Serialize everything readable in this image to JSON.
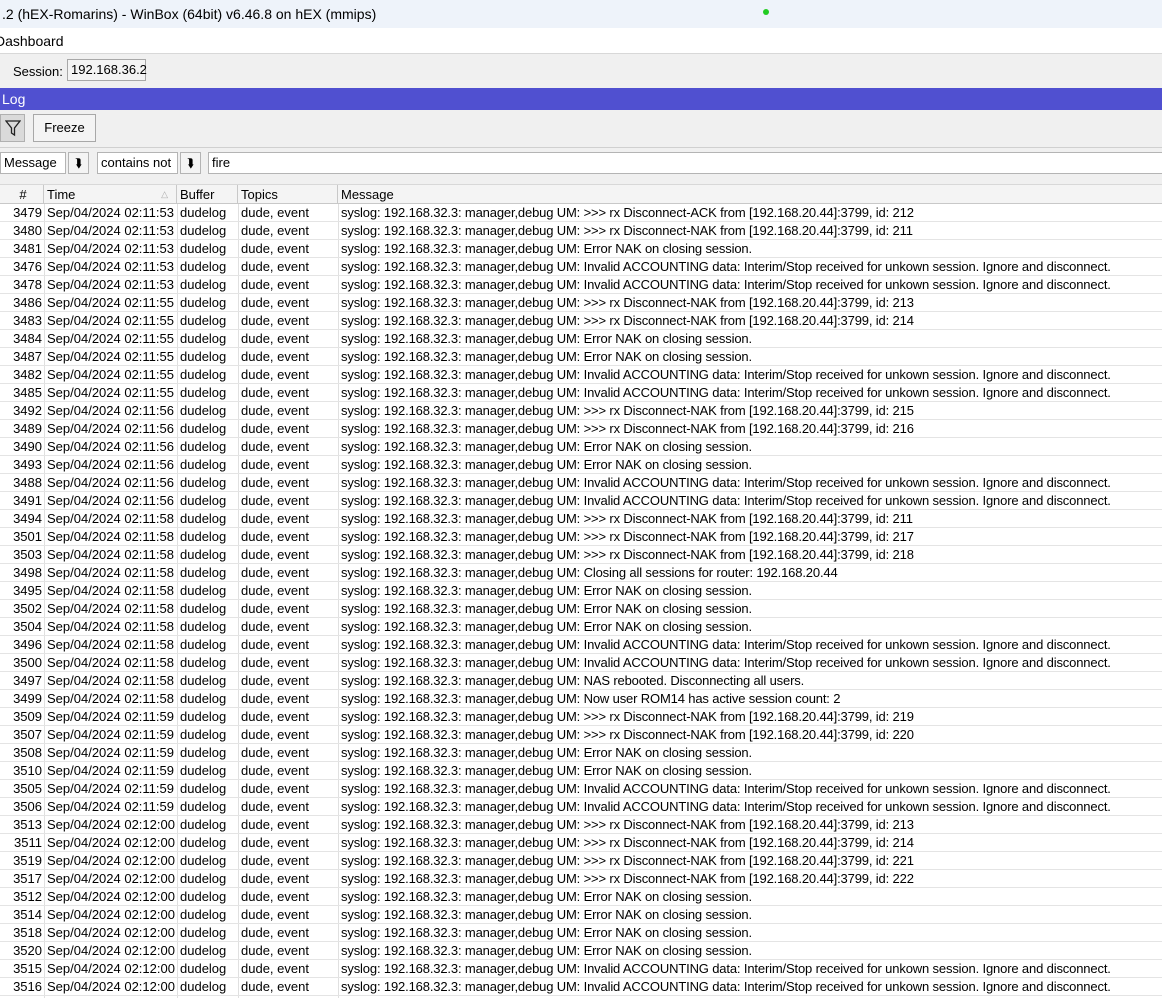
{
  "window": {
    "title": ".2 (hEX-Romarins) - WinBox (64bit) v6.46.8 on hEX (mmips)",
    "status_color": "#22cc22"
  },
  "menu": {
    "item": "Dashboard"
  },
  "session": {
    "label": "Session:",
    "value": "192.168.36.2"
  },
  "log": {
    "title": "Log",
    "title_color": "#5050d0"
  },
  "toolbar": {
    "filter_icon": "funnel-icon",
    "freeze_label": "Freeze"
  },
  "filter": {
    "field": "Message",
    "operator": "contains not",
    "value": "fire"
  },
  "columns": [
    "#",
    "Time",
    "Buffer",
    "Topics",
    "Message"
  ],
  "sort": {
    "column": "Time",
    "icon": "sort-ascending-icon"
  },
  "rows": [
    [
      "3479",
      "Sep/04/2024 02:11:53",
      "dudelog",
      "dude, event",
      "syslog: 192.168.32.3: manager,debug UM: >>> rx Disconnect-ACK from [192.168.20.44]:3799, id: 212"
    ],
    [
      "3480",
      "Sep/04/2024 02:11:53",
      "dudelog",
      "dude, event",
      "syslog: 192.168.32.3: manager,debug UM: >>> rx Disconnect-NAK from [192.168.20.44]:3799, id: 211"
    ],
    [
      "3481",
      "Sep/04/2024 02:11:53",
      "dudelog",
      "dude, event",
      "syslog: 192.168.32.3: manager,debug UM: Error NAK on closing session."
    ],
    [
      "3476",
      "Sep/04/2024 02:11:53",
      "dudelog",
      "dude, event",
      "syslog: 192.168.32.3: manager,debug UM: Invalid ACCOUNTING data: Interim/Stop received for unkown session. Ignore and disconnect."
    ],
    [
      "3478",
      "Sep/04/2024 02:11:53",
      "dudelog",
      "dude, event",
      "syslog: 192.168.32.3: manager,debug UM: Invalid ACCOUNTING data: Interim/Stop received for unkown session. Ignore and disconnect."
    ],
    [
      "3486",
      "Sep/04/2024 02:11:55",
      "dudelog",
      "dude, event",
      "syslog: 192.168.32.3: manager,debug UM: >>> rx Disconnect-NAK from [192.168.20.44]:3799, id: 213"
    ],
    [
      "3483",
      "Sep/04/2024 02:11:55",
      "dudelog",
      "dude, event",
      "syslog: 192.168.32.3: manager,debug UM: >>> rx Disconnect-NAK from [192.168.20.44]:3799, id: 214"
    ],
    [
      "3484",
      "Sep/04/2024 02:11:55",
      "dudelog",
      "dude, event",
      "syslog: 192.168.32.3: manager,debug UM: Error NAK on closing session."
    ],
    [
      "3487",
      "Sep/04/2024 02:11:55",
      "dudelog",
      "dude, event",
      "syslog: 192.168.32.3: manager,debug UM: Error NAK on closing session."
    ],
    [
      "3482",
      "Sep/04/2024 02:11:55",
      "dudelog",
      "dude, event",
      "syslog: 192.168.32.3: manager,debug UM: Invalid ACCOUNTING data: Interim/Stop received for unkown session. Ignore and disconnect."
    ],
    [
      "3485",
      "Sep/04/2024 02:11:55",
      "dudelog",
      "dude, event",
      "syslog: 192.168.32.3: manager,debug UM: Invalid ACCOUNTING data: Interim/Stop received for unkown session. Ignore and disconnect."
    ],
    [
      "3492",
      "Sep/04/2024 02:11:56",
      "dudelog",
      "dude, event",
      "syslog: 192.168.32.3: manager,debug UM: >>> rx Disconnect-NAK from [192.168.20.44]:3799, id: 215"
    ],
    [
      "3489",
      "Sep/04/2024 02:11:56",
      "dudelog",
      "dude, event",
      "syslog: 192.168.32.3: manager,debug UM: >>> rx Disconnect-NAK from [192.168.20.44]:3799, id: 216"
    ],
    [
      "3490",
      "Sep/04/2024 02:11:56",
      "dudelog",
      "dude, event",
      "syslog: 192.168.32.3: manager,debug UM: Error NAK on closing session."
    ],
    [
      "3493",
      "Sep/04/2024 02:11:56",
      "dudelog",
      "dude, event",
      "syslog: 192.168.32.3: manager,debug UM: Error NAK on closing session."
    ],
    [
      "3488",
      "Sep/04/2024 02:11:56",
      "dudelog",
      "dude, event",
      "syslog: 192.168.32.3: manager,debug UM: Invalid ACCOUNTING data: Interim/Stop received for unkown session. Ignore and disconnect."
    ],
    [
      "3491",
      "Sep/04/2024 02:11:56",
      "dudelog",
      "dude, event",
      "syslog: 192.168.32.3: manager,debug UM: Invalid ACCOUNTING data: Interim/Stop received for unkown session. Ignore and disconnect."
    ],
    [
      "3494",
      "Sep/04/2024 02:11:58",
      "dudelog",
      "dude, event",
      "syslog: 192.168.32.3: manager,debug UM: >>> rx Disconnect-NAK from [192.168.20.44]:3799, id: 211"
    ],
    [
      "3501",
      "Sep/04/2024 02:11:58",
      "dudelog",
      "dude, event",
      "syslog: 192.168.32.3: manager,debug UM: >>> rx Disconnect-NAK from [192.168.20.44]:3799, id: 217"
    ],
    [
      "3503",
      "Sep/04/2024 02:11:58",
      "dudelog",
      "dude, event",
      "syslog: 192.168.32.3: manager,debug UM: >>> rx Disconnect-NAK from [192.168.20.44]:3799, id: 218"
    ],
    [
      "3498",
      "Sep/04/2024 02:11:58",
      "dudelog",
      "dude, event",
      "syslog: 192.168.32.3: manager,debug UM: Closing all sessions for router: 192.168.20.44"
    ],
    [
      "3495",
      "Sep/04/2024 02:11:58",
      "dudelog",
      "dude, event",
      "syslog: 192.168.32.3: manager,debug UM: Error NAK on closing session."
    ],
    [
      "3502",
      "Sep/04/2024 02:11:58",
      "dudelog",
      "dude, event",
      "syslog: 192.168.32.3: manager,debug UM: Error NAK on closing session."
    ],
    [
      "3504",
      "Sep/04/2024 02:11:58",
      "dudelog",
      "dude, event",
      "syslog: 192.168.32.3: manager,debug UM: Error NAK on closing session."
    ],
    [
      "3496",
      "Sep/04/2024 02:11:58",
      "dudelog",
      "dude, event",
      "syslog: 192.168.32.3: manager,debug UM: Invalid ACCOUNTING data: Interim/Stop received for unkown session. Ignore and disconnect."
    ],
    [
      "3500",
      "Sep/04/2024 02:11:58",
      "dudelog",
      "dude, event",
      "syslog: 192.168.32.3: manager,debug UM: Invalid ACCOUNTING data: Interim/Stop received for unkown session. Ignore and disconnect."
    ],
    [
      "3497",
      "Sep/04/2024 02:11:58",
      "dudelog",
      "dude, event",
      "syslog: 192.168.32.3: manager,debug UM: NAS rebooted. Disconnecting all users."
    ],
    [
      "3499",
      "Sep/04/2024 02:11:58",
      "dudelog",
      "dude, event",
      "syslog: 192.168.32.3: manager,debug UM: Now user ROM14 has active session count: 2"
    ],
    [
      "3509",
      "Sep/04/2024 02:11:59",
      "dudelog",
      "dude, event",
      "syslog: 192.168.32.3: manager,debug UM: >>> rx Disconnect-NAK from [192.168.20.44]:3799, id: 219"
    ],
    [
      "3507",
      "Sep/04/2024 02:11:59",
      "dudelog",
      "dude, event",
      "syslog: 192.168.32.3: manager,debug UM: >>> rx Disconnect-NAK from [192.168.20.44]:3799, id: 220"
    ],
    [
      "3508",
      "Sep/04/2024 02:11:59",
      "dudelog",
      "dude, event",
      "syslog: 192.168.32.3: manager,debug UM: Error NAK on closing session."
    ],
    [
      "3510",
      "Sep/04/2024 02:11:59",
      "dudelog",
      "dude, event",
      "syslog: 192.168.32.3: manager,debug UM: Error NAK on closing session."
    ],
    [
      "3505",
      "Sep/04/2024 02:11:59",
      "dudelog",
      "dude, event",
      "syslog: 192.168.32.3: manager,debug UM: Invalid ACCOUNTING data: Interim/Stop received for unkown session. Ignore and disconnect."
    ],
    [
      "3506",
      "Sep/04/2024 02:11:59",
      "dudelog",
      "dude, event",
      "syslog: 192.168.32.3: manager,debug UM: Invalid ACCOUNTING data: Interim/Stop received for unkown session. Ignore and disconnect."
    ],
    [
      "3513",
      "Sep/04/2024 02:12:00",
      "dudelog",
      "dude, event",
      "syslog: 192.168.32.3: manager,debug UM: >>> rx Disconnect-NAK from [192.168.20.44]:3799, id: 213"
    ],
    [
      "3511",
      "Sep/04/2024 02:12:00",
      "dudelog",
      "dude, event",
      "syslog: 192.168.32.3: manager,debug UM: >>> rx Disconnect-NAK from [192.168.20.44]:3799, id: 214"
    ],
    [
      "3519",
      "Sep/04/2024 02:12:00",
      "dudelog",
      "dude, event",
      "syslog: 192.168.32.3: manager,debug UM: >>> rx Disconnect-NAK from [192.168.20.44]:3799, id: 221"
    ],
    [
      "3517",
      "Sep/04/2024 02:12:00",
      "dudelog",
      "dude, event",
      "syslog: 192.168.32.3: manager,debug UM: >>> rx Disconnect-NAK from [192.168.20.44]:3799, id: 222"
    ],
    [
      "3512",
      "Sep/04/2024 02:12:00",
      "dudelog",
      "dude, event",
      "syslog: 192.168.32.3: manager,debug UM: Error NAK on closing session."
    ],
    [
      "3514",
      "Sep/04/2024 02:12:00",
      "dudelog",
      "dude, event",
      "syslog: 192.168.32.3: manager,debug UM: Error NAK on closing session."
    ],
    [
      "3518",
      "Sep/04/2024 02:12:00",
      "dudelog",
      "dude, event",
      "syslog: 192.168.32.3: manager,debug UM: Error NAK on closing session."
    ],
    [
      "3520",
      "Sep/04/2024 02:12:00",
      "dudelog",
      "dude, event",
      "syslog: 192.168.32.3: manager,debug UM: Error NAK on closing session."
    ],
    [
      "3515",
      "Sep/04/2024 02:12:00",
      "dudelog",
      "dude, event",
      "syslog: 192.168.32.3: manager,debug UM: Invalid ACCOUNTING data: Interim/Stop received for unkown session. Ignore and disconnect."
    ],
    [
      "3516",
      "Sep/04/2024 02:12:00",
      "dudelog",
      "dude, event",
      "syslog: 192.168.32.3: manager,debug UM: Invalid ACCOUNTING data: Interim/Stop received for unkown session. Ignore and disconnect."
    ]
  ]
}
